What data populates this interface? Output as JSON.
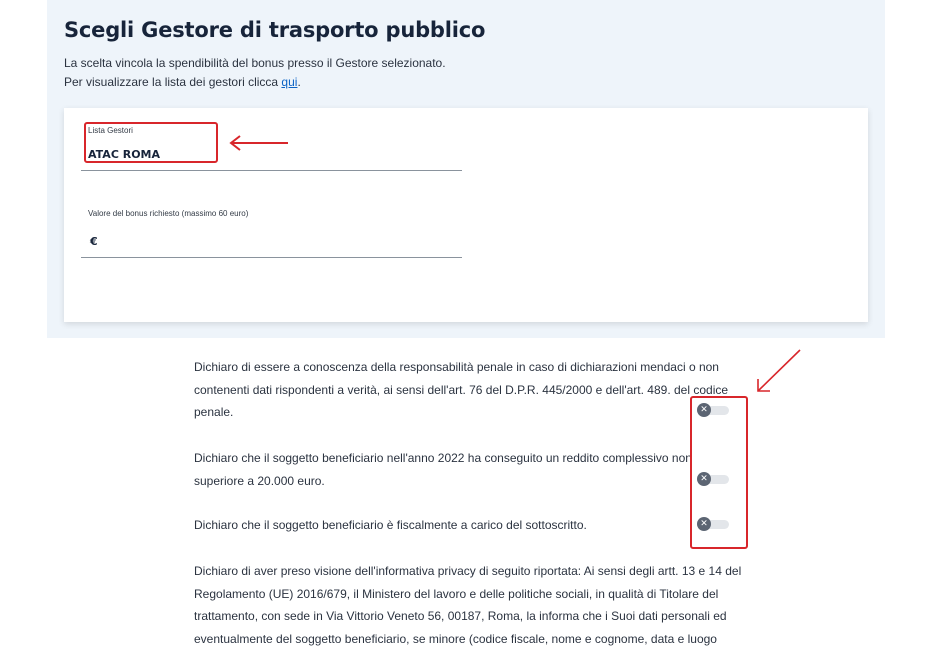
{
  "header": {
    "title": "Scegli Gestore di trasporto pubblico",
    "intro_line1": "La scelta vincola la spendibilità del bonus presso il Gestore selezionato.",
    "intro_line2_prefix": "Per visualizzare la lista dei gestori clicca ",
    "intro_link": "qui",
    "intro_line2_suffix": "."
  },
  "form": {
    "operator_label": "Lista Gestori",
    "operator_value": "ATAC ROMA",
    "amount_label": "Valore del bonus richiesto (massimo 60 euro)",
    "amount_currency": "€",
    "amount_value": ""
  },
  "declarations": [
    {
      "text": "Dichiaro di essere a conoscenza della responsabilità penale in caso di dichiarazioni mendaci o non contenenti dati rispondenti a verità, ai sensi dell'art. 76 del D.P.R. 445/2000 e dell'art. 489. del codice penale.",
      "checked": false,
      "toggle_icon": "close-icon"
    },
    {
      "text": "Dichiaro che il soggetto beneficiario nell'anno 2022 ha conseguito un reddito complessivo non superiore a 20.000 euro.",
      "checked": false,
      "toggle_icon": "close-icon"
    },
    {
      "text": "Dichiaro che il soggetto beneficiario è fiscalmente a carico del sottoscritto.",
      "checked": false,
      "toggle_icon": "close-icon"
    },
    {
      "text": "Dichiaro di aver preso visione dell'informativa privacy di seguito riportata: Ai sensi degli artt. 13 e 14 del Regolamento (UE) 2016/679, il Ministero del lavoro e delle politiche sociali, in qualità di Titolare del trattamento, con sede in Via Vittorio Veneto 56, 00187, Roma, la informa che i Suoi dati personali ed eventualmente del soggetto beneficiario, se minore (codice fiscale, nome e cognome, data e luogo"
    }
  ],
  "toggle_glyph": "✕",
  "colors": {
    "panel_background": "#eef4fa",
    "title": "#17243a",
    "link": "#0b63c5",
    "annotation_red": "#d8262b",
    "toggle_knob": "#5c6573",
    "toggle_track": "#e3e6ea"
  }
}
